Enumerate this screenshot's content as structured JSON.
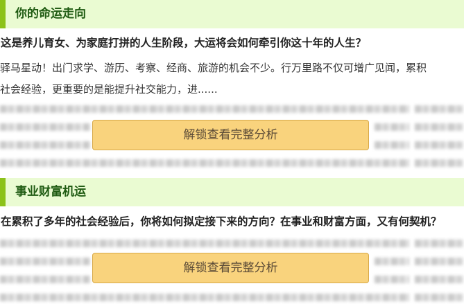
{
  "sections": [
    {
      "title": "你的命运走向",
      "question": "这是养儿育女、为家庭打拼的人生阶段，大运将会如何牵引你这十年的人生？",
      "body_lines": [
        "驿马星动！出门求学、游历、考察、经商、旅游的机会不少。行万里路不仅可增广见闻，累积",
        "社会经验，更重要的是能提升社交能力，进......"
      ],
      "unlock_label": "解锁查看完整分析"
    },
    {
      "title": "事业财富机运",
      "question": "在累积了多年的社会经验后，你将如何拟定接下来的方向？在事业和财富方面，又有何契机？",
      "unlock_label": "解锁查看完整分析"
    }
  ],
  "colors": {
    "header_bg": "#eafbd2",
    "header_accent": "#8cc21a",
    "header_text": "#1f5b12",
    "button_bg": "#f9d37d",
    "button_border": "#d7a847"
  }
}
